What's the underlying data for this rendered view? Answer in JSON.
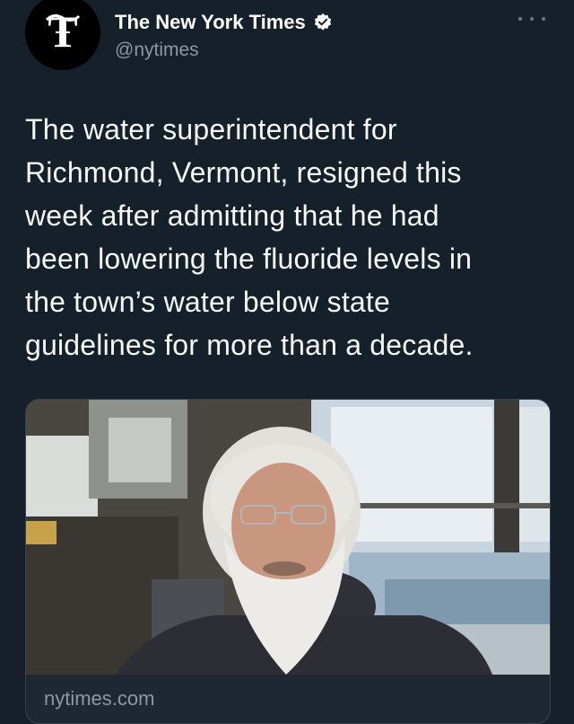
{
  "account": {
    "display_name": "The New York Times",
    "handle": "@nytimes",
    "avatar_icon": "nyt-logo-icon",
    "verified_icon": "verified-badge-icon",
    "accent_color": "#1d9bf0"
  },
  "tweet": {
    "text": "The water superintendent for\nRichmond, Vermont, resigned this\nweek after admitting that he had\nbeen lowering the fluoride levels in\nthe town’s water below state\nguidelines for more than a decade."
  },
  "card": {
    "image_icon": "news-photo-man-with-beard",
    "domain": "nytimes.com"
  },
  "menu": {
    "more_icon": "more-options-icon"
  },
  "colors": {
    "background": "#15202b",
    "text_primary": "#f7f9f9",
    "text_secondary": "#8b98a5",
    "border": "#38444d"
  }
}
